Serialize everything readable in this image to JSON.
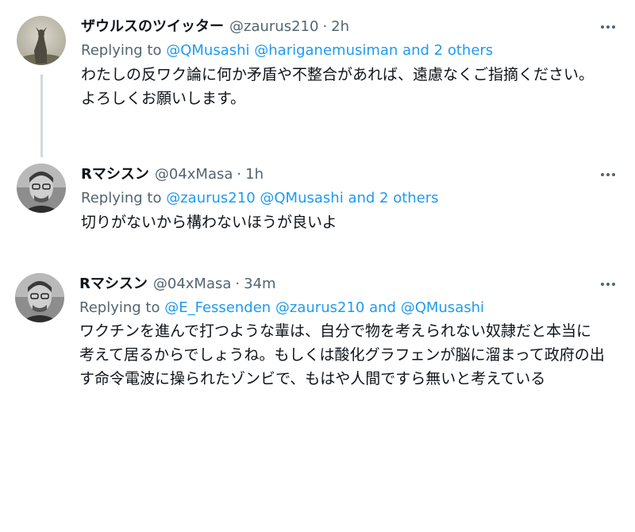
{
  "tweets": [
    {
      "name": "ザウルスのツイッター",
      "handle": "@zaurus210",
      "sep": "·",
      "time": "2h",
      "replying_prefix": "Replying to",
      "replying_links": [
        "@QMusashi",
        "@hariganemusiman",
        "and 2 others"
      ],
      "text": "わたしの反ワク論に何か矛盾や不整合があれば、遠慮なくご指摘ください。よろしくお願いします。",
      "avatar_icon": "deer-avatar-icon"
    },
    {
      "name": "Rマシスン",
      "handle": "@04xMasa",
      "sep": "·",
      "time": "1h",
      "replying_prefix": "Replying to",
      "replying_links": [
        "@zaurus210",
        "@QMusashi",
        "and 2 others"
      ],
      "text": "切りがないから構わないほうが良いよ",
      "avatar_icon": "person-avatar-icon"
    },
    {
      "name": "Rマシスン",
      "handle": "@04xMasa",
      "sep": "·",
      "time": "34m",
      "replying_prefix": "Replying to",
      "replying_links": [
        "@E_Fessenden",
        "@zaurus210",
        "and",
        "@QMusashi"
      ],
      "text": "ワクチンを進んで打つような輩は、自分で物を考えられない奴隷だと本当に考えて居るからでしょうね。もしくは酸化グラフェンが脳に溜まって政府の出す命令電波に操られたゾンビで、もはや人間ですら無いと考えている",
      "avatar_icon": "person-avatar-icon"
    }
  ],
  "colors": {
    "link": "#1d9bf0",
    "muted": "#536471",
    "text": "#0f1419",
    "thread_line": "#cfd9de"
  }
}
